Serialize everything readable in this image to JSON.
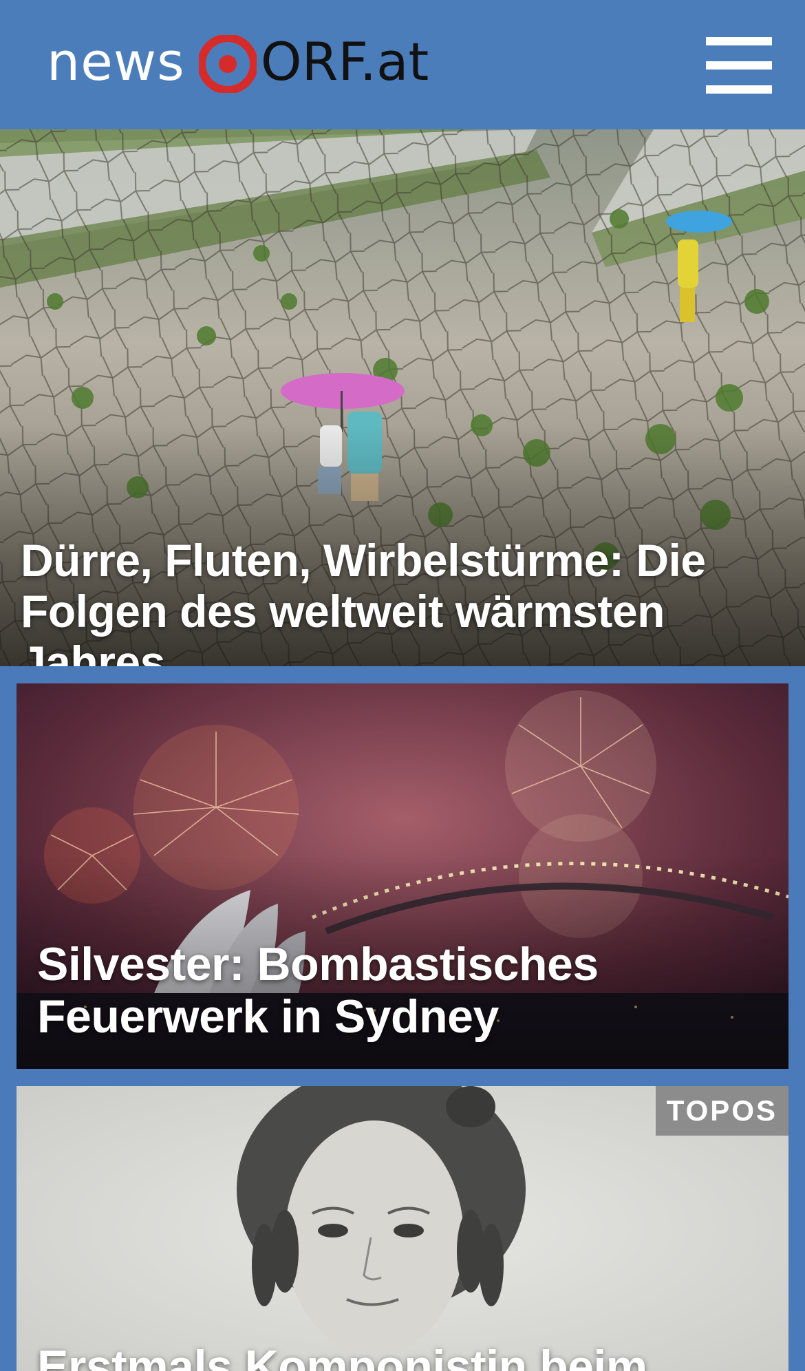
{
  "header": {
    "logo_news": "news",
    "logo_orf": "ORF.at",
    "menu_icon": "hamburger-menu-icon",
    "background_color": "#4b7dbb",
    "logo_mark_color": "#d62b2b"
  },
  "articles": [
    {
      "headline": "Dürre, Fluten, Wirbelstürme: Die Folgen des weltweit wärmsten Jahres",
      "image": "drought-riverbed-photo"
    },
    {
      "headline": "Silvester: Bombastisches Feuerwerk in Sydney",
      "image": "sydney-fireworks-photo"
    },
    {
      "badge": "TOPOS",
      "headline": "Erstmals Komponistin beim",
      "image": "portrait-woman-drawing"
    }
  ]
}
